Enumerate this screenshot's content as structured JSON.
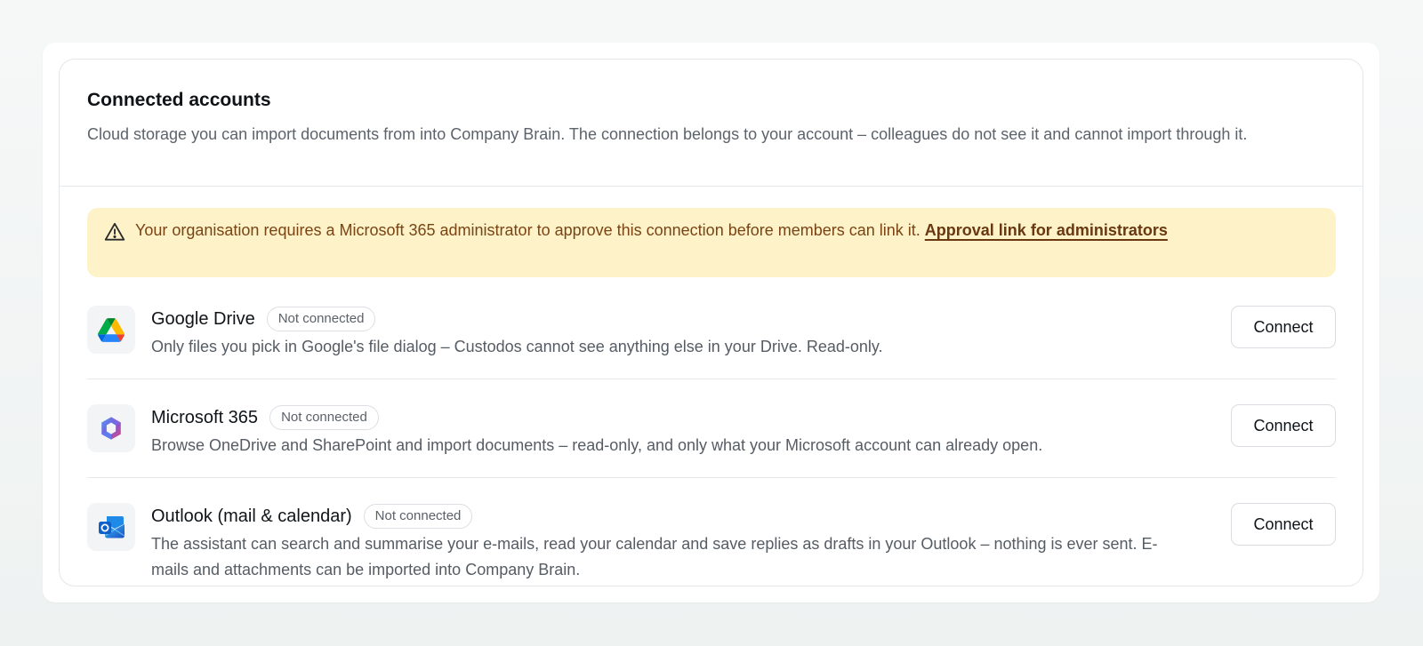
{
  "section": {
    "title": "Connected accounts",
    "description": "Cloud storage you can import documents from into Company Brain. The connection belongs to your account – colleagues do not see it and cannot import through it."
  },
  "alert": {
    "icon": "warning-triangle-icon",
    "text": "Your organisation requires a Microsoft 365 administrator to approve this connection before members can link it. ",
    "link_label": "Approval link for administrators",
    "background": "#fdf2c8",
    "text_color": "#7a4414"
  },
  "providers": [
    {
      "icon": "google-drive-icon",
      "name": "Google Drive",
      "status": "Not connected",
      "description": "Only files you pick in Google's file dialog – Custodos cannot see anything else in your Drive. Read-only.",
      "action_label": "Connect"
    },
    {
      "icon": "microsoft-365-icon",
      "name": "Microsoft 365",
      "status": "Not connected",
      "description": "Browse OneDrive and SharePoint and import documents – read-only, and only what your Microsoft account can already open.",
      "action_label": "Connect"
    },
    {
      "icon": "outlook-icon",
      "name": "Outlook (mail & calendar)",
      "status": "Not connected",
      "description": "The assistant can search and summarise your e-mails, read your calendar and save replies as drafts in your Outlook – nothing is ever sent. E-mails and attachments can be imported into Company Brain.",
      "action_label": "Connect"
    }
  ]
}
